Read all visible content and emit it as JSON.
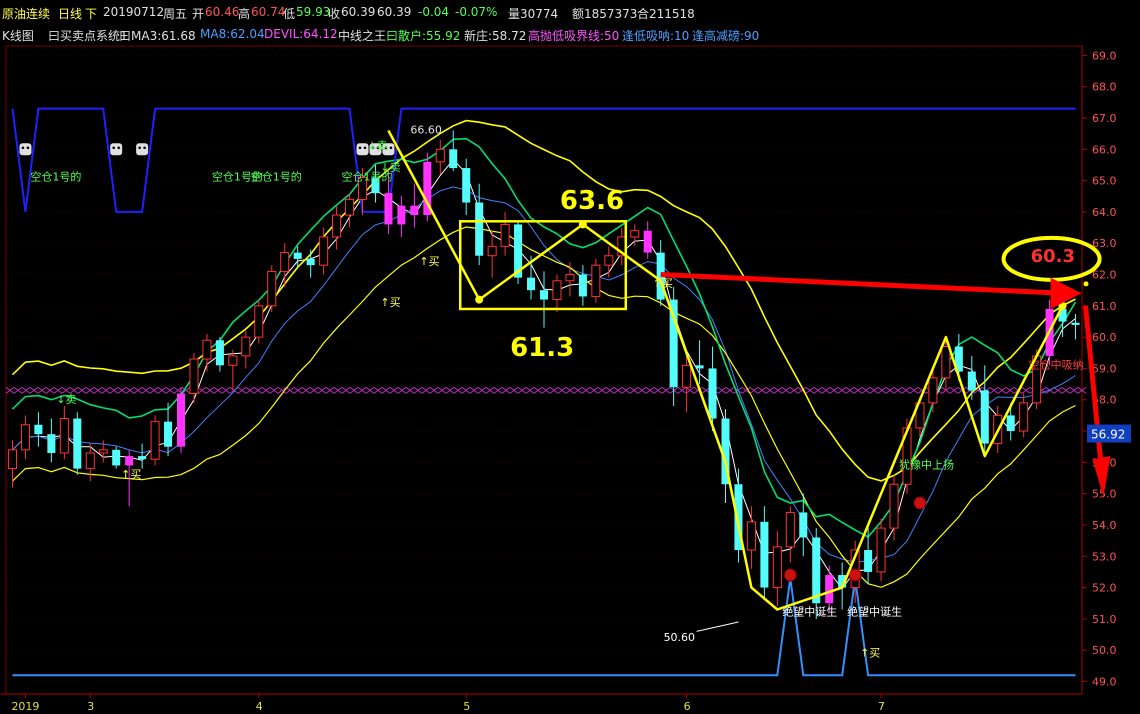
{
  "header": {
    "symbol": "原油连续",
    "period": "日线",
    "adjust": "下",
    "date": "20190712",
    "weekday": "周五",
    "open_label": "开",
    "open": "60.46",
    "high_label": "高",
    "high": "60.74",
    "low_label": "低",
    "low": "59.93",
    "close_label": "收",
    "close": "60.39",
    "last": "60.39",
    "change": "-0.04",
    "change_pct": "-0.07%",
    "volume": "量30774",
    "amount": "额1857373",
    "open_interest": "合211518"
  },
  "indicators": {
    "kline": "K线图",
    "system": "曰买卖点系统1",
    "ma3": "曰MA3:61.68",
    "ma8": "MA8:62.04",
    "devil": "DEVIL:64.12",
    "center": "中线之王",
    "retail": "曰散户:55.92",
    "newbank": "新庄:58.72",
    "hl": "高抛低吸界线:50",
    "low_absorb": "逢低吸呐:10",
    "high_sell": "逢高减磅:90"
  },
  "colors": {
    "up": "#ff3232",
    "down": "#54fcfc",
    "signal_bar": "#ff32ff",
    "yellow": "#ffff00",
    "red_arrow": "#ff0000",
    "blue_line": "#2020ff",
    "green_line": "#00e070",
    "magenta_x": "#c030c0",
    "white": "#ffffff"
  },
  "chart_data": {
    "type": "candlestick",
    "ylim": [
      48.6,
      69.3
    ],
    "y_ticks": [
      "49.0",
      "50.0",
      "51.0",
      "52.0",
      "53.0",
      "54.0",
      "55.0",
      "56.0",
      "57.0",
      "58.0",
      "59.0",
      "60.0",
      "61.0",
      "62.0",
      "63.0",
      "64.0",
      "65.0",
      "66.0",
      "67.0",
      "68.0",
      "69.0"
    ],
    "x_labels": [
      {
        "label": "2019",
        "index": 1
      },
      {
        "label": "3",
        "index": 6
      },
      {
        "label": "4",
        "index": 19
      },
      {
        "label": "5",
        "index": 35
      },
      {
        "label": "6",
        "index": 52
      },
      {
        "label": "7",
        "index": 67
      }
    ],
    "current_price_tag": "56.92",
    "current_price": 56.92,
    "candles": [
      [
        55.8,
        56.7,
        55.2,
        56.4
      ],
      [
        56.4,
        57.5,
        56.1,
        57.2
      ],
      [
        57.2,
        57.6,
        56.5,
        56.9
      ],
      [
        56.9,
        57.4,
        56.0,
        56.3
      ],
      [
        56.3,
        57.8,
        56.1,
        57.4
      ],
      [
        57.4,
        57.6,
        55.6,
        55.8
      ],
      [
        55.8,
        56.6,
        55.4,
        56.3
      ],
      [
        56.3,
        56.7,
        56.0,
        56.4
      ],
      [
        56.4,
        56.5,
        55.8,
        55.9
      ],
      [
        55.9,
        56.4,
        54.6,
        56.2
      ],
      [
        56.2,
        56.6,
        55.8,
        56.1
      ],
      [
        56.1,
        57.5,
        55.9,
        57.3
      ],
      [
        57.3,
        57.9,
        56.2,
        56.5
      ],
      [
        56.5,
        58.4,
        56.3,
        58.2
      ],
      [
        58.2,
        59.5,
        57.9,
        59.3
      ],
      [
        59.3,
        60.1,
        58.9,
        59.9
      ],
      [
        59.9,
        60.0,
        58.9,
        59.1
      ],
      [
        59.1,
        59.6,
        58.3,
        59.4
      ],
      [
        59.4,
        60.2,
        59.0,
        60.0
      ],
      [
        60.0,
        61.2,
        59.8,
        61.0
      ],
      [
        61.0,
        62.3,
        60.8,
        62.1
      ],
      [
        62.1,
        63.0,
        61.6,
        62.7
      ],
      [
        62.7,
        62.9,
        62.2,
        62.5
      ],
      [
        62.5,
        62.8,
        61.9,
        62.3
      ],
      [
        62.3,
        63.5,
        62.0,
        63.2
      ],
      [
        63.2,
        64.2,
        62.8,
        63.9
      ],
      [
        63.9,
        64.6,
        63.5,
        64.4
      ],
      [
        64.4,
        65.4,
        63.9,
        65.1
      ],
      [
        65.1,
        65.5,
        64.3,
        64.6
      ],
      [
        64.6,
        65.3,
        63.3,
        63.6
      ],
      [
        63.6,
        64.5,
        63.2,
        64.2
      ],
      [
        64.2,
        64.9,
        63.5,
        63.9
      ],
      [
        63.9,
        65.9,
        63.7,
        65.6
      ],
      [
        65.6,
        66.3,
        65.2,
        66.0
      ],
      [
        66.0,
        66.6,
        65.3,
        65.4
      ],
      [
        65.4,
        65.7,
        63.9,
        64.3
      ],
      [
        64.3,
        64.9,
        62.3,
        62.6
      ],
      [
        62.6,
        63.4,
        61.9,
        62.9
      ],
      [
        62.9,
        64.0,
        62.6,
        63.6
      ],
      [
        63.6,
        63.7,
        61.7,
        61.9
      ],
      [
        61.9,
        62.6,
        61.2,
        61.5
      ],
      [
        61.5,
        62.1,
        60.3,
        61.2
      ],
      [
        61.2,
        62.0,
        60.8,
        61.8
      ],
      [
        61.8,
        62.4,
        61.3,
        62.0
      ],
      [
        62.0,
        62.3,
        61.0,
        61.3
      ],
      [
        61.3,
        62.5,
        61.1,
        62.3
      ],
      [
        62.3,
        62.9,
        61.9,
        62.6
      ],
      [
        62.6,
        63.5,
        62.3,
        63.2
      ],
      [
        63.2,
        63.6,
        62.9,
        63.4
      ],
      [
        63.4,
        63.7,
        62.5,
        62.7
      ],
      [
        62.7,
        63.1,
        61.0,
        61.2
      ],
      [
        61.2,
        61.6,
        57.8,
        58.4
      ],
      [
        58.4,
        59.6,
        57.6,
        59.1
      ],
      [
        59.1,
        59.9,
        58.5,
        59.0
      ],
      [
        59.0,
        59.7,
        57.0,
        57.4
      ],
      [
        57.4,
        57.7,
        54.7,
        55.3
      ],
      [
        55.3,
        55.8,
        52.8,
        53.2
      ],
      [
        53.2,
        54.6,
        52.6,
        54.1
      ],
      [
        54.1,
        54.6,
        51.6,
        52.0
      ],
      [
        52.0,
        53.8,
        51.4,
        53.3
      ],
      [
        53.3,
        54.6,
        52.8,
        54.4
      ],
      [
        54.4,
        55.0,
        53.0,
        53.6
      ],
      [
        53.6,
        53.9,
        51.0,
        51.5
      ],
      [
        51.5,
        52.7,
        51.2,
        52.4
      ],
      [
        52.4,
        52.8,
        51.3,
        52.0
      ],
      [
        52.0,
        53.5,
        51.5,
        53.2
      ],
      [
        53.2,
        54.0,
        52.1,
        52.5
      ],
      [
        52.5,
        54.2,
        52.2,
        53.9
      ],
      [
        53.9,
        55.6,
        53.5,
        55.3
      ],
      [
        55.3,
        57.4,
        55.0,
        57.1
      ],
      [
        57.1,
        58.1,
        56.8,
        57.9
      ],
      [
        57.9,
        59.0,
        57.6,
        58.7
      ],
      [
        58.7,
        60.0,
        58.3,
        59.7
      ],
      [
        59.7,
        60.1,
        58.6,
        58.9
      ],
      [
        58.9,
        59.4,
        58.0,
        58.3
      ],
      [
        58.3,
        59.1,
        56.2,
        56.6
      ],
      [
        56.6,
        57.8,
        56.3,
        57.5
      ],
      [
        57.5,
        57.9,
        56.7,
        57.0
      ],
      [
        57.0,
        58.2,
        56.8,
        57.9
      ],
      [
        57.9,
        59.6,
        57.7,
        59.4
      ],
      [
        59.4,
        61.2,
        59.1,
        60.9
      ],
      [
        60.9,
        61.3,
        60.0,
        60.5
      ],
      [
        60.46,
        60.74,
        59.93,
        60.39
      ]
    ],
    "signal_bars": [
      9,
      13,
      29,
      30,
      31,
      32,
      49,
      63,
      80
    ],
    "price_labels": [
      "63.6",
      "61.3",
      "60.3",
      "66.60",
      "50.60"
    ],
    "annotations": [
      {
        "text": "空仓1号的",
        "index": 2,
        "y": 65.0
      },
      {
        "text": "空仓1号的",
        "index": 16,
        "y": 65.0
      },
      {
        "text": "空仓1号的",
        "index": 19,
        "y": 65.0
      },
      {
        "text": "空仓1号的",
        "index": 26,
        "y": 65.0
      },
      {
        "text": "↓卖",
        "index": 4,
        "y": 57.9
      },
      {
        "text": "↓卖",
        "index": 28,
        "y": 66.0
      },
      {
        "text": "↓卖",
        "index": 29,
        "y": 65.3
      },
      {
        "text": "↑买",
        "index": 9,
        "y": 55.5
      },
      {
        "text": "↑买",
        "index": 29,
        "y": 61.0
      },
      {
        "text": "↑买",
        "index": 32,
        "y": 62.3
      },
      {
        "text": "↑买",
        "index": 50,
        "y": 61.6
      },
      {
        "text": "↑买",
        "index": 66,
        "y": 49.8
      },
      {
        "text": "绝望中诞生",
        "index": 60,
        "y": 51.1
      },
      {
        "text": "绝望中诞生",
        "index": 65,
        "y": 51.1
      },
      {
        "text": "犹豫中上扬",
        "index": 69,
        "y": 55.8
      },
      {
        "text": "空仓中吸纳",
        "index": 79,
        "y": 59.0
      }
    ]
  }
}
